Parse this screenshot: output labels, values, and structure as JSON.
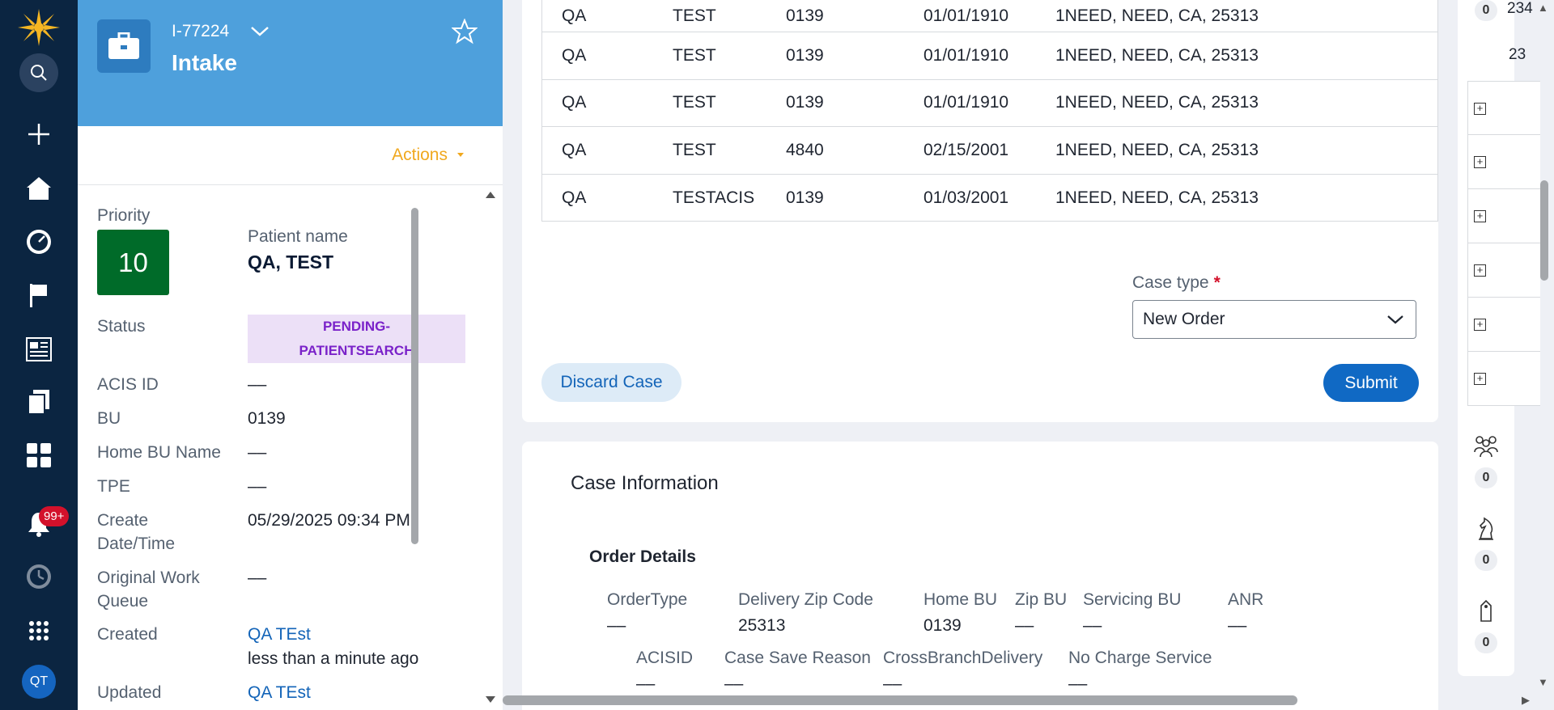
{
  "rail": {
    "notification_count": "99+",
    "avatar_initials": "QT"
  },
  "case": {
    "id": "I-77224",
    "name": "Intake",
    "actions_label": "Actions",
    "priority_label": "Priority",
    "priority_value": "10",
    "patient_name_label": "Patient name",
    "patient_name_value": "QA, TEST",
    "status_label": "Status",
    "status_line1": "PENDING-",
    "status_line2": "PATIENTSEARCH",
    "acis_id_label": "ACIS ID",
    "acis_id_value": "––",
    "bu_label": "BU",
    "bu_value": "0139",
    "home_bu_name_label": "Home BU Name",
    "home_bu_name_value": "––",
    "tpe_label": "TPE",
    "tpe_value": "––",
    "create_dt_label_1": "Create",
    "create_dt_label_2": "Date/Time",
    "create_dt_value": "05/29/2025 09:34 PM",
    "orig_wq_label_1": "Original Work",
    "orig_wq_label_2": "Queue",
    "orig_wq_value": "––",
    "created_label": "Created",
    "created_by": "QA TEst",
    "created_when": "less than a minute ago",
    "updated_label": "Updated",
    "updated_by": "QA TEst"
  },
  "results_table": {
    "rows": [
      [
        "QA",
        "TEST",
        "0139",
        "01/01/1910",
        "1NEED, NEED, CA, 25313"
      ],
      [
        "QA",
        "TEST",
        "0139",
        "01/01/1910",
        "1NEED, NEED, CA, 25313"
      ],
      [
        "QA",
        "TEST",
        "0139",
        "01/01/1910",
        "1NEED, NEED, CA, 25313"
      ],
      [
        "QA",
        "TEST",
        "4840",
        "02/15/2001",
        "1NEED, NEED, CA, 25313"
      ],
      [
        "QA",
        "TESTACIS",
        "0139",
        "01/03/2001",
        "1NEED, NEED, CA, 25313"
      ]
    ]
  },
  "form": {
    "case_type_label": "Case type",
    "required_mark": "*",
    "case_type_value": "New Order",
    "discard_label": "Discard Case",
    "submit_label": "Submit"
  },
  "case_info": {
    "title": "Case Information",
    "order_details_title": "Order Details",
    "order_type_label": "OrderType",
    "order_type_value": "––",
    "delivery_zip_label": "Delivery Zip Code",
    "delivery_zip_value": "25313",
    "home_bu_label": "Home BU",
    "home_bu_value": "0139",
    "zip_bu_label": "Zip BU",
    "zip_bu_value": "––",
    "servicing_bu_label": "Servicing BU",
    "servicing_bu_value": "––",
    "anr_label": "ANR",
    "anr_value": "––",
    "acisid_label": "ACISID",
    "acisid_value": "––",
    "save_reason_label": "Case Save Reason",
    "save_reason_value": "––",
    "cross_branch_label": "CrossBranchDelivery",
    "cross_branch_value": "––",
    "no_charge_label": "No Charge Service",
    "no_charge_value": "––"
  },
  "utility": {
    "top_count": "0",
    "partial_1": "234",
    "partial_2": "23",
    "followers_count": "0",
    "chess_count": "0",
    "tag_count": "0"
  },
  "colors": {
    "rail_bg": "#0b2541",
    "header_blue": "#4ea0dc",
    "priority_green": "#006b29",
    "status_purple": "#7a22c9",
    "actions_orange": "#f0a81e",
    "link_blue": "#1364b8",
    "submit_blue": "#1069c4"
  }
}
